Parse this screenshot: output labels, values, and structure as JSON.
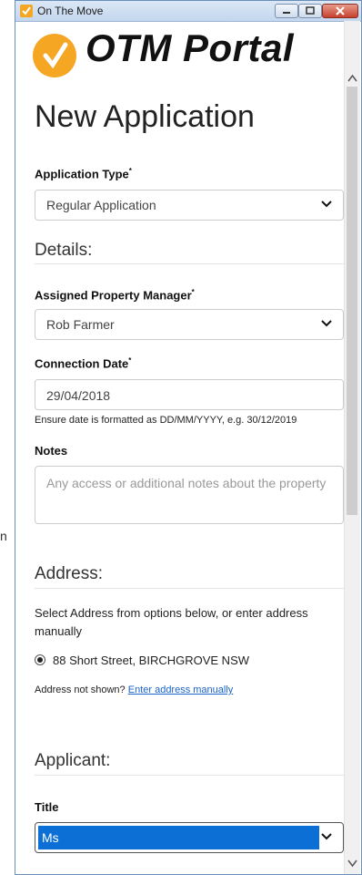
{
  "desktop_text": "n",
  "window": {
    "title": "On The Move",
    "logo_text": "OTM Portal"
  },
  "page": {
    "title": "New Application"
  },
  "application_type": {
    "label": "Application Type",
    "required_mark": "*",
    "value": "Regular Application"
  },
  "details": {
    "heading": "Details:",
    "property_manager": {
      "label": "Assigned Property Manager",
      "required_mark": "*",
      "value": "Rob Farmer"
    },
    "connection_date": {
      "label": "Connection Date",
      "required_mark": "*",
      "value": "29/04/2018",
      "help": "Ensure date is formatted as DD/MM/YYYY, e.g. 30/12/2019"
    },
    "notes": {
      "label": "Notes",
      "placeholder": "Any access or additional notes about the property"
    }
  },
  "address": {
    "heading": "Address:",
    "instruction": "Select Address from options below, or enter address manually",
    "option": "88 Short Street, BIRCHGROVE NSW",
    "not_shown_text": "Address not shown?",
    "manual_link": "Enter address manually"
  },
  "applicant": {
    "heading": "Applicant:",
    "title_label": "Title",
    "title_value": "Ms"
  },
  "colors": {
    "accent": "#f5a623",
    "selection": "#0b6fd6",
    "link": "#1a63c8"
  }
}
